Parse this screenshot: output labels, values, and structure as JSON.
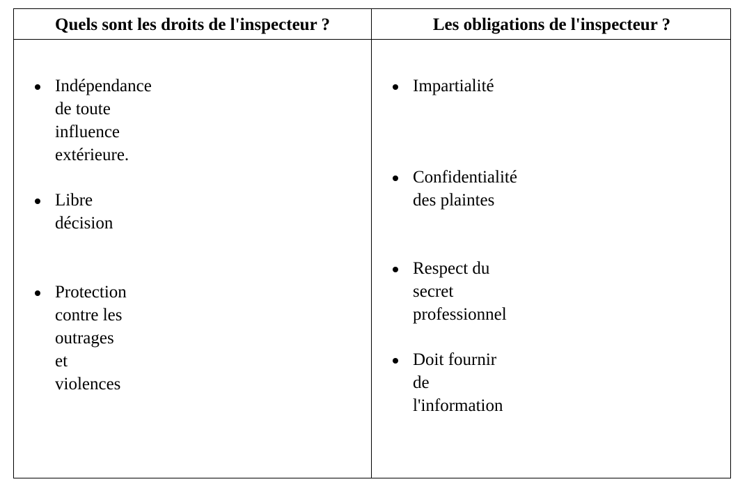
{
  "table": {
    "headers": {
      "left": "Quels sont les droits de l'inspecteur ?",
      "right": "Les obligations de l'inspecteur ?"
    },
    "left_items": [
      "Indépendance de toute influence\nextérieure.",
      "Libre décision",
      "Protection contre les outrages et\nviolences"
    ],
    "right_items": [
      "Impartialité",
      "Confidentialité des plaintes",
      "Respect du secret professionnel",
      "Doit fournir de l'information"
    ]
  }
}
